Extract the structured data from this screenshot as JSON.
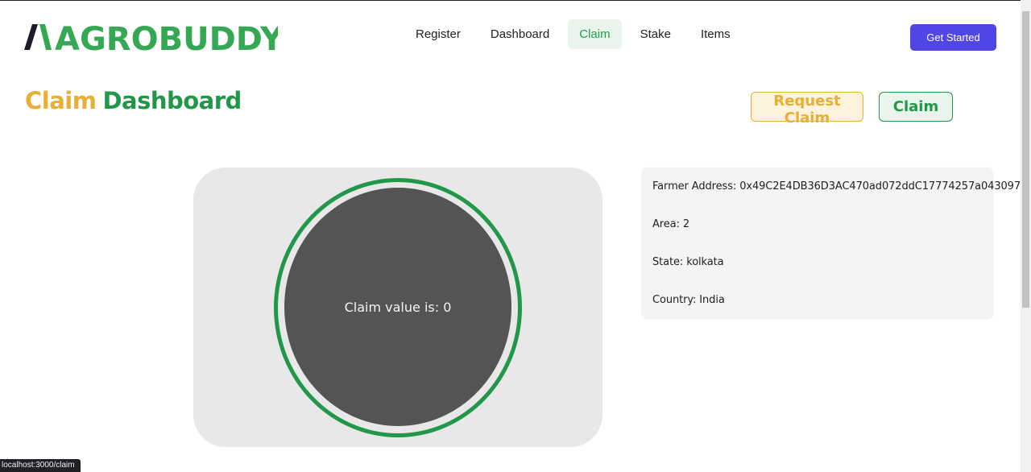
{
  "brand": {
    "name": "AGROBUDDY",
    "color_dark": "#1b1b2b",
    "color_green": "#34a853"
  },
  "nav": {
    "items": [
      {
        "label": "Register"
      },
      {
        "label": "Dashboard"
      },
      {
        "label": "Claim",
        "active": true
      },
      {
        "label": "Stake"
      },
      {
        "label": "Items"
      }
    ],
    "cta_label": "Get Started"
  },
  "page": {
    "title_part1": "Claim",
    "title_part2": "Dashboard",
    "request_claim_label": "Request Claim",
    "claim_label": "Claim"
  },
  "claim_card": {
    "value_text": "Claim value is: 0"
  },
  "farmer_info": {
    "address": "Farmer Address: 0x49C2E4DB36D3AC470ad072ddC17774257a043097",
    "area": "Area: 2",
    "state": "State: kolkata",
    "country": "Country: India"
  },
  "status_bar": {
    "url": "localhost:3000/claim"
  },
  "colors": {
    "accent_green": "#22974a",
    "accent_orange": "#e9ae36",
    "cta_purple": "#4f46e5",
    "disc_gray": "#545456"
  }
}
